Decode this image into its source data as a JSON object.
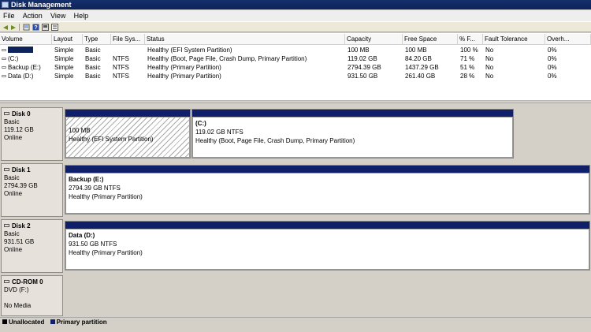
{
  "window": {
    "title": "Disk Management"
  },
  "menu": [
    "File",
    "Action",
    "View",
    "Help"
  ],
  "toolbar": {
    "buttons": [
      "back-icon",
      "forward-icon",
      "properties-icon",
      "help-icon",
      "console-icon"
    ]
  },
  "volumes": {
    "headers": [
      "Volume",
      "Layout",
      "Type",
      "File Sys...",
      "Status",
      "Capacity",
      "Free Space",
      "% F...",
      "Fault Tolerance",
      "Overh..."
    ],
    "rows": [
      {
        "volume": "",
        "layout": "Simple",
        "type": "Basic",
        "fs": "",
        "status": "Healthy (EFI System Partition)",
        "capacity": "100 MB",
        "free": "100 MB",
        "pct": "100 %",
        "fault": "No",
        "overhead": "0%"
      },
      {
        "volume": "(C:)",
        "layout": "Simple",
        "type": "Basic",
        "fs": "NTFS",
        "status": "Healthy (Boot, Page File, Crash Dump, Primary Partition)",
        "capacity": "119.02 GB",
        "free": "84.20 GB",
        "pct": "71 %",
        "fault": "No",
        "overhead": "0%"
      },
      {
        "volume": "Backup (E:)",
        "layout": "Simple",
        "type": "Basic",
        "fs": "NTFS",
        "status": "Healthy (Primary Partition)",
        "capacity": "2794.39 GB",
        "free": "1437.29 GB",
        "pct": "51 %",
        "fault": "No",
        "overhead": "0%"
      },
      {
        "volume": "Data (D:)",
        "layout": "Simple",
        "type": "Basic",
        "fs": "NTFS",
        "status": "Healthy (Primary Partition)",
        "capacity": "931.50 GB",
        "free": "261.40 GB",
        "pct": "28 %",
        "fault": "No",
        "overhead": "0%"
      }
    ]
  },
  "disks": [
    {
      "name": "Disk 0",
      "type": "Basic",
      "size": "119.12 GB",
      "state": "Online",
      "partitions": [
        {
          "title": "",
          "line1": "100 MB",
          "line2": "Healthy (EFI System Partition)"
        },
        {
          "title": "(C:)",
          "line1": "119.02 GB NTFS",
          "line2": "Healthy (Boot, Page File, Crash Dump, Primary Partition)"
        }
      ]
    },
    {
      "name": "Disk 1",
      "type": "Basic",
      "size": "2794.39 GB",
      "state": "Online",
      "partitions": [
        {
          "title": "Backup  (E:)",
          "line1": "2794.39 GB NTFS",
          "line2": "Healthy (Primary Partition)"
        }
      ]
    },
    {
      "name": "Disk 2",
      "type": "Basic",
      "size": "931.51 GB",
      "state": "Online",
      "partitions": [
        {
          "title": "Data  (D:)",
          "line1": "931.50 GB NTFS",
          "line2": "Healthy (Primary Partition)"
        }
      ]
    },
    {
      "name": "CD-ROM 0",
      "type": "DVD (F:)",
      "size": "",
      "state": "No Media",
      "partitions": []
    }
  ],
  "legend": [
    {
      "label": "Unallocated",
      "color": "#000000"
    },
    {
      "label": "Primary partition",
      "color": "#0f1f6a"
    }
  ]
}
